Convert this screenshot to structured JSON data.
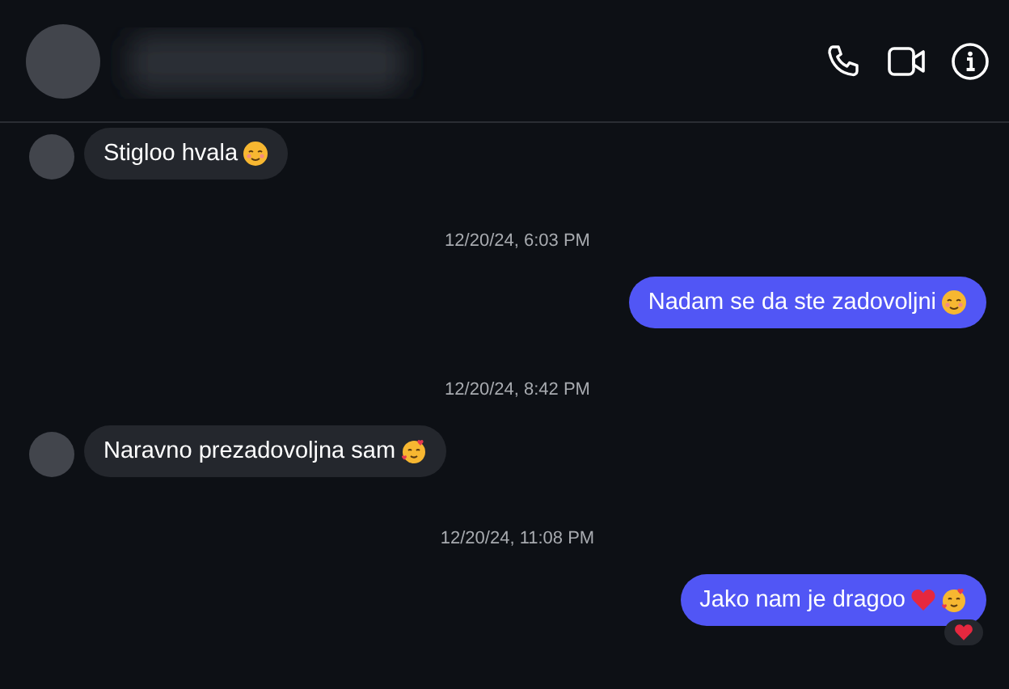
{
  "header": {
    "actions": [
      {
        "kind": "call"
      },
      {
        "kind": "video"
      },
      {
        "kind": "info"
      }
    ]
  },
  "messages": [
    {
      "kind": "incoming",
      "text": "Stigloo hvala",
      "emojis": [
        {
          "kind": "blush"
        }
      ]
    },
    {
      "kind": "timestamp",
      "text": "12/20/24, 6:03 PM"
    },
    {
      "kind": "outgoing",
      "text": "Nadam se da ste zadovoljni",
      "emojis": [
        {
          "kind": "blush"
        }
      ]
    },
    {
      "kind": "timestamp",
      "text": "12/20/24, 8:42 PM"
    },
    {
      "kind": "incoming",
      "text": "Naravno prezadovoljna sam",
      "emojis": [
        {
          "kind": "hearts-face"
        }
      ]
    },
    {
      "kind": "timestamp",
      "text": "12/20/24, 11:08 PM"
    },
    {
      "kind": "outgoing",
      "text": "Jako nam je dragoo",
      "emojis": [
        {
          "kind": "heart"
        },
        {
          "kind": "hearts-face"
        }
      ],
      "reaction": {
        "kind": "heart"
      }
    }
  ]
}
